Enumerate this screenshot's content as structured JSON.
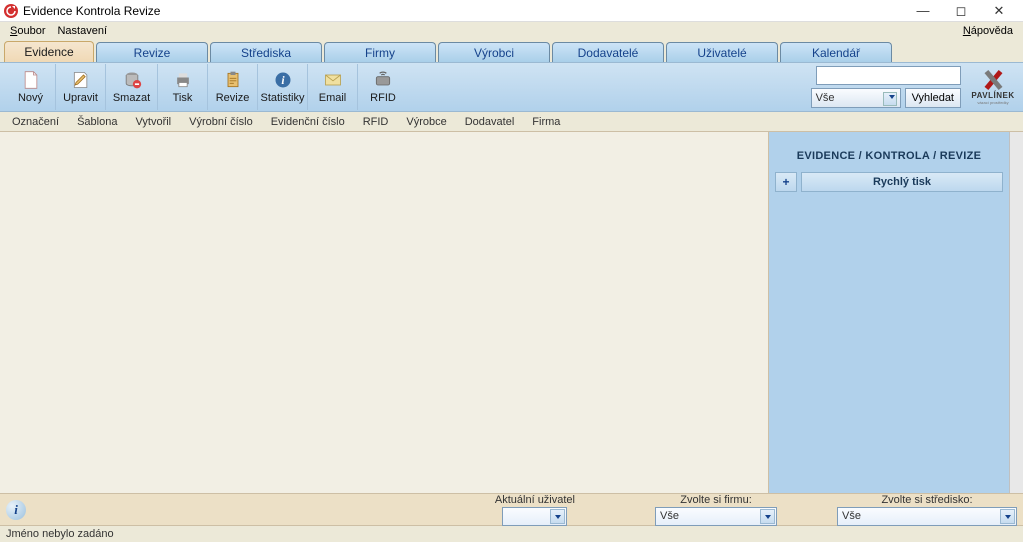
{
  "window": {
    "title": "Evidence Kontrola Revize"
  },
  "menubar": {
    "soubor": "Soubor",
    "soubor_u": "S",
    "nastaveni": "Nastavení",
    "napoveda": "Nápověda",
    "napoveda_u": "N"
  },
  "tabs": [
    {
      "label": "Evidence",
      "active": true
    },
    {
      "label": "Revize"
    },
    {
      "label": "Střediska"
    },
    {
      "label": "Firmy"
    },
    {
      "label": "Výrobci"
    },
    {
      "label": "Dodavatelé"
    },
    {
      "label": "Uživatelé"
    },
    {
      "label": "Kalendář"
    }
  ],
  "toolbar": {
    "novy": "Nový",
    "upravit": "Upravit",
    "smazat": "Smazat",
    "tisk": "Tisk",
    "revize": "Revize",
    "statistiky": "Statistiky",
    "email": "Email",
    "rfid": "RFID",
    "search_filter": "Vše",
    "search_btn": "Vyhledat",
    "brand": "PAVLÍNEK"
  },
  "columns": {
    "oznaceni": "Označení",
    "sablona": "Šablona",
    "vytvoril": "Vytvořil",
    "vyrobni_cislo": "Výrobní číslo",
    "evidencni_cislo": "Evidenční číslo",
    "rfid": "RFID",
    "vyrobce": "Výrobce",
    "dodavatel": "Dodavatel",
    "firma": "Firma"
  },
  "side": {
    "title": "EVIDENCE / KONTROLA / REVIZE",
    "plus": "+",
    "quick_print": "Rychlý tisk"
  },
  "bottom": {
    "user_label": "Aktuální uživatel",
    "user_value": "",
    "firma_label": "Zvolte si firmu:",
    "firma_value": "Vše",
    "stredisko_label": "Zvolte si středisko:",
    "stredisko_value": "Vše"
  },
  "status": {
    "text": "Jméno nebylo zadáno"
  }
}
